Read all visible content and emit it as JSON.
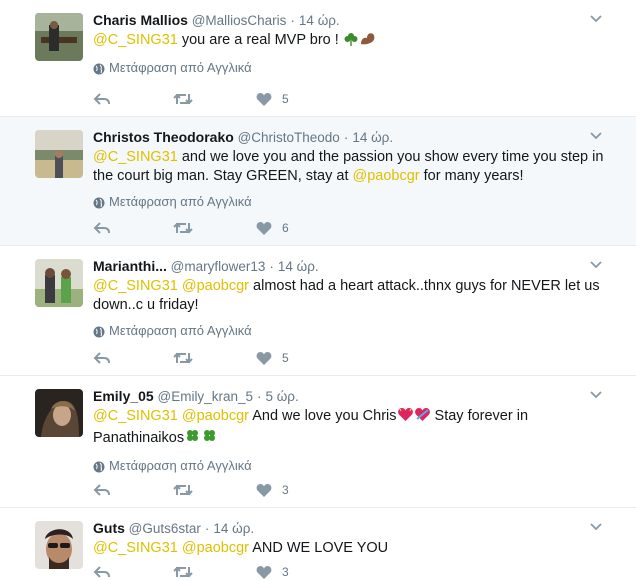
{
  "tweets": [
    {
      "fullname": "Charis Mallios",
      "username": "@MalliosCharis",
      "separator": "·",
      "time": "14 ώρ.",
      "mention1": "@C_SING31",
      "mention2": "",
      "text": " you are a real MVP bro ! ",
      "text2": "",
      "text3": "",
      "translate": "Μετάφραση από Αγγλικά",
      "likes": "5"
    },
    {
      "fullname": "Christos Theodorako",
      "username": "@ChristoTheodo",
      "separator": "·",
      "time": "14 ώρ.",
      "mention1": "@C_SING31",
      "text": " and we love you and the passion you show every time you step in the court big man. Stay GREEN, stay at ",
      "mention2": "@paobcgr",
      "text2": " for many years!",
      "translate": "Μετάφραση από Αγγλικά",
      "likes": "6"
    },
    {
      "fullname": "Marianthi...",
      "username": "@maryflower13",
      "separator": "·",
      "time": "14 ώρ.",
      "mention1": "@C_SING31",
      "mention2": "@paobcgr",
      "text": " almost had a heart attack..thnx guys for NEVER let us down..c u friday!",
      "translate": "Μετάφραση από Αγγλικά",
      "likes": "5"
    },
    {
      "fullname": "Emily_05",
      "username": "@Emily_kran_5",
      "separator": "·",
      "time": "5 ώρ.",
      "mention1": "@C_SING31",
      "mention2": "@paobcgr",
      "text": " And we love you Chris",
      "text2": " Stay forever in Panathinaikos",
      "translate": "Μετάφραση από Αγγλικά",
      "likes": "3"
    },
    {
      "fullname": "Guts",
      "username": "@Guts6star",
      "separator": "·",
      "time": "14 ώρ.",
      "mention1": "@C_SING31",
      "mention2": "@paobcgr",
      "text": " AND WE LOVE YOU",
      "likes": "3"
    }
  ],
  "colors": {
    "mention": "#e0c000",
    "highlight_bg": "#f5f8fa",
    "meta": "#657786",
    "icon": "#8899a6"
  },
  "icons": [
    "reply-icon",
    "retweet-icon",
    "like-icon",
    "globe-icon",
    "caret-down-icon",
    "shamrock-icon",
    "flexed-biceps-icon",
    "sparkling-heart-icon",
    "heart-with-ribbon-icon",
    "four-leaf-clover-icon"
  ]
}
